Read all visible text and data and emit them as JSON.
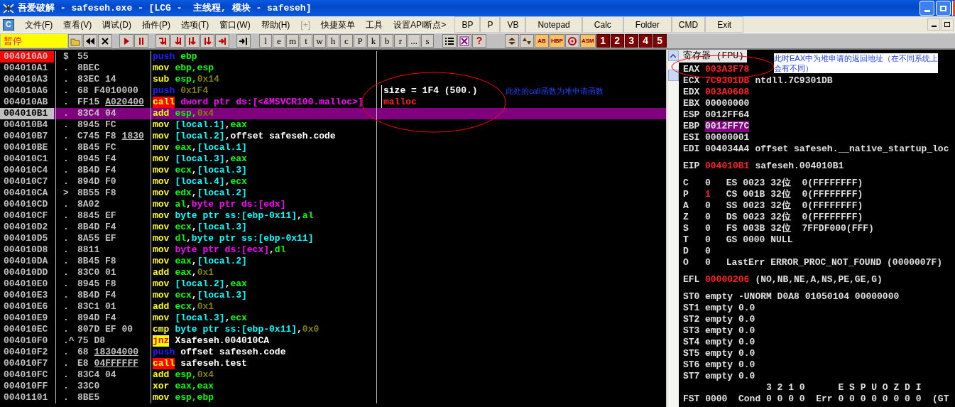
{
  "window": {
    "title": "吾爱破解 - safeseh.exe - [LCG -  主线程, 模块 - safeseh]"
  },
  "menu": {
    "icon_letter": "C",
    "items": [
      {
        "label": "文件(F)",
        "disabled": false
      },
      {
        "label": "查看(V)",
        "disabled": false
      },
      {
        "label": "调试(D)",
        "disabled": false
      },
      {
        "label": "插件(P)",
        "disabled": false
      },
      {
        "label": "选项(T)",
        "disabled": false
      },
      {
        "label": "窗口(W)",
        "disabled": false
      },
      {
        "label": "帮助(H)",
        "disabled": false
      },
      {
        "label": "[+]",
        "disabled": true
      },
      {
        "label": "快捷菜单",
        "disabled": false
      },
      {
        "label": "工具",
        "disabled": false
      },
      {
        "label": "设置API断点>",
        "disabled": false
      }
    ],
    "tool_buttons": [
      "BP",
      "P",
      "VB",
      "Notepad",
      "Calc",
      "Folder",
      "CMD",
      "Exit"
    ]
  },
  "toolbar": {
    "status": "暂停",
    "letter_buttons": [
      "l",
      "e",
      "m",
      "t",
      "w",
      "h",
      "c",
      "P",
      "k",
      "b",
      "r",
      "...",
      "s"
    ],
    "help": "?",
    "plugin_buttons": [
      {
        "kind": "swap"
      },
      {
        "kind": "sort"
      },
      {
        "kind": "text",
        "label": "AB"
      },
      {
        "kind": "text",
        "label": "HBP"
      },
      {
        "kind": "target"
      },
      {
        "kind": "text",
        "label": "ASM"
      }
    ],
    "number_buttons": [
      "1",
      "2",
      "3",
      "4",
      "5"
    ]
  },
  "disassembly": {
    "rows": [
      {
        "address": "004010A0",
        "mark": "$",
        "bytes": "55",
        "op": {
          "text": "push",
          "kind": "push"
        },
        "args": [
          {
            "text": "ebp",
            "kind": "reg"
          }
        ],
        "selected": false,
        "breakpoint": true
      },
      {
        "address": "004010A1",
        "mark": ".",
        "bytes": "8BEC",
        "op": {
          "text": "mov",
          "kind": "plain"
        },
        "args": [
          {
            "text": "ebp,esp",
            "kind": "reg"
          }
        ],
        "selected": false,
        "breakpoint": false
      },
      {
        "address": "004010A3",
        "mark": ".",
        "bytes": "83EC 14",
        "op": {
          "text": "sub",
          "kind": "plain"
        },
        "args": [
          {
            "text": "esp,",
            "kind": "reg"
          },
          {
            "text": "0x14",
            "kind": "const"
          }
        ],
        "selected": false,
        "breakpoint": false
      },
      {
        "address": "004010A6",
        "mark": ".",
        "bytes": "68 F4010000",
        "op": {
          "text": "push",
          "kind": "push"
        },
        "args": [
          {
            "text": "0x1F4",
            "kind": "const"
          }
        ],
        "comment": {
          "text": "size = 1F4 (500.)",
          "kind": "arg"
        },
        "selected": false,
        "breakpoint": false
      },
      {
        "address": "004010AB",
        "mark": ".",
        "bytes": "FF15",
        "operand_bytes": "A020400",
        "op": {
          "text": "call",
          "kind": "call"
        },
        "args": [
          {
            "text": "dword ptr ds:[<&MSVCR100.malloc>]",
            "kind": "ptr"
          }
        ],
        "comment": {
          "text": "malloc",
          "kind": "func"
        },
        "selected": false,
        "breakpoint": false
      },
      {
        "address": "004010B1",
        "mark": ".",
        "bytes": "83C4 04",
        "op": {
          "text": "add",
          "kind": "plain"
        },
        "args": [
          {
            "text": "esp,",
            "kind": "reg"
          },
          {
            "text": "0x4",
            "kind": "const"
          }
        ],
        "selected": true,
        "breakpoint": false
      },
      {
        "address": "004010B4",
        "mark": ".",
        "bytes": "8945 FC",
        "op": {
          "text": "mov",
          "kind": "plain"
        },
        "args": [
          {
            "text": "[local.1]",
            "kind": "mem"
          },
          {
            "text": ",",
            "kind": "text"
          },
          {
            "text": "eax",
            "kind": "reg"
          }
        ],
        "selected": false,
        "breakpoint": false
      },
      {
        "address": "004010B7",
        "mark": ".",
        "bytes": "C745 F8",
        "operand_bytes": "1830",
        "op": {
          "text": "mov",
          "kind": "plain"
        },
        "args": [
          {
            "text": "[local.2]",
            "kind": "mem"
          },
          {
            "text": ",offset safeseh.code",
            "kind": "text"
          }
        ],
        "selected": false,
        "breakpoint": false
      },
      {
        "address": "004010BE",
        "mark": ".",
        "bytes": "8B45 FC",
        "op": {
          "text": "mov",
          "kind": "plain"
        },
        "args": [
          {
            "text": "eax",
            "kind": "reg"
          },
          {
            "text": ",",
            "kind": "text"
          },
          {
            "text": "[local.1]",
            "kind": "mem"
          }
        ],
        "selected": false,
        "breakpoint": false
      },
      {
        "address": "004010C1",
        "mark": ".",
        "bytes": "8945 F4",
        "op": {
          "text": "mov",
          "kind": "plain"
        },
        "args": [
          {
            "text": "[local.3]",
            "kind": "mem"
          },
          {
            "text": ",",
            "kind": "text"
          },
          {
            "text": "eax",
            "kind": "reg"
          }
        ],
        "selected": false,
        "breakpoint": false
      },
      {
        "address": "004010C4",
        "mark": ".",
        "bytes": "8B4D F4",
        "op": {
          "text": "mov",
          "kind": "plain"
        },
        "args": [
          {
            "text": "ecx",
            "kind": "reg"
          },
          {
            "text": ",",
            "kind": "text"
          },
          {
            "text": "[local.3]",
            "kind": "mem"
          }
        ],
        "selected": false,
        "breakpoint": false
      },
      {
        "address": "004010C7",
        "mark": ".",
        "bytes": "894D F0",
        "op": {
          "text": "mov",
          "kind": "plain"
        },
        "args": [
          {
            "text": "[local.4]",
            "kind": "mem"
          },
          {
            "text": ",",
            "kind": "text"
          },
          {
            "text": "ecx",
            "kind": "reg"
          }
        ],
        "selected": false,
        "breakpoint": false
      },
      {
        "address": "004010CA",
        "mark": ">",
        "bytes": "8B55 F8",
        "op": {
          "text": "mov",
          "kind": "plain"
        },
        "args": [
          {
            "text": "edx",
            "kind": "reg"
          },
          {
            "text": ",",
            "kind": "text"
          },
          {
            "text": "[local.2]",
            "kind": "mem"
          }
        ],
        "selected": false,
        "breakpoint": false
      },
      {
        "address": "004010CD",
        "mark": ".",
        "bytes": "8A02",
        "op": {
          "text": "mov",
          "kind": "plain"
        },
        "args": [
          {
            "text": "al",
            "kind": "reg"
          },
          {
            "text": ",",
            "kind": "text"
          },
          {
            "text": "byte ptr ds:[edx]",
            "kind": "ptr"
          }
        ],
        "selected": false,
        "breakpoint": false
      },
      {
        "address": "004010CF",
        "mark": ".",
        "bytes": "8845 EF",
        "op": {
          "text": "mov",
          "kind": "plain"
        },
        "args": [
          {
            "text": "byte ptr ss:[ebp-0x11]",
            "kind": "mem"
          },
          {
            "text": ",",
            "kind": "text"
          },
          {
            "text": "al",
            "kind": "reg"
          }
        ],
        "selected": false,
        "breakpoint": false
      },
      {
        "address": "004010D2",
        "mark": ".",
        "bytes": "8B4D F4",
        "op": {
          "text": "mov",
          "kind": "plain"
        },
        "args": [
          {
            "text": "ecx",
            "kind": "reg"
          },
          {
            "text": ",",
            "kind": "text"
          },
          {
            "text": "[local.3]",
            "kind": "mem"
          }
        ],
        "selected": false,
        "breakpoint": false
      },
      {
        "address": "004010D5",
        "mark": ".",
        "bytes": "8A55 EF",
        "op": {
          "text": "mov",
          "kind": "plain"
        },
        "args": [
          {
            "text": "dl",
            "kind": "reg"
          },
          {
            "text": ",",
            "kind": "text"
          },
          {
            "text": "byte ptr ss:[ebp-0x11]",
            "kind": "mem"
          }
        ],
        "selected": false,
        "breakpoint": false
      },
      {
        "address": "004010D8",
        "mark": ".",
        "bytes": "8811",
        "op": {
          "text": "mov",
          "kind": "plain"
        },
        "args": [
          {
            "text": "byte ptr ds:[ecx]",
            "kind": "ptr"
          },
          {
            "text": ",",
            "kind": "text"
          },
          {
            "text": "dl",
            "kind": "reg"
          }
        ],
        "selected": false,
        "breakpoint": false
      },
      {
        "address": "004010DA",
        "mark": ".",
        "bytes": "8B45 F8",
        "op": {
          "text": "mov",
          "kind": "plain"
        },
        "args": [
          {
            "text": "eax",
            "kind": "reg"
          },
          {
            "text": ",",
            "kind": "text"
          },
          {
            "text": "[local.2]",
            "kind": "mem"
          }
        ],
        "selected": false,
        "breakpoint": false
      },
      {
        "address": "004010DD",
        "mark": ".",
        "bytes": "83C0 01",
        "op": {
          "text": "add",
          "kind": "plain"
        },
        "args": [
          {
            "text": "eax",
            "kind": "reg"
          },
          {
            "text": ",",
            "kind": "text"
          },
          {
            "text": "0x1",
            "kind": "const"
          }
        ],
        "selected": false,
        "breakpoint": false
      },
      {
        "address": "004010E0",
        "mark": ".",
        "bytes": "8945 F8",
        "op": {
          "text": "mov",
          "kind": "plain"
        },
        "args": [
          {
            "text": "[local.2]",
            "kind": "mem"
          },
          {
            "text": ",",
            "kind": "text"
          },
          {
            "text": "eax",
            "kind": "reg"
          }
        ],
        "selected": false,
        "breakpoint": false
      },
      {
        "address": "004010E3",
        "mark": ".",
        "bytes": "8B4D F4",
        "op": {
          "text": "mov",
          "kind": "plain"
        },
        "args": [
          {
            "text": "ecx",
            "kind": "reg"
          },
          {
            "text": ",",
            "kind": "text"
          },
          {
            "text": "[local.3]",
            "kind": "mem"
          }
        ],
        "selected": false,
        "breakpoint": false
      },
      {
        "address": "004010E6",
        "mark": ".",
        "bytes": "83C1 01",
        "op": {
          "text": "add",
          "kind": "plain"
        },
        "args": [
          {
            "text": "ecx",
            "kind": "reg"
          },
          {
            "text": ",",
            "kind": "text"
          },
          {
            "text": "0x1",
            "kind": "const"
          }
        ],
        "selected": false,
        "breakpoint": false
      },
      {
        "address": "004010E9",
        "mark": ".",
        "bytes": "894D F4",
        "op": {
          "text": "mov",
          "kind": "plain"
        },
        "args": [
          {
            "text": "[local.3]",
            "kind": "mem"
          },
          {
            "text": ",",
            "kind": "text"
          },
          {
            "text": "ecx",
            "kind": "reg"
          }
        ],
        "selected": false,
        "breakpoint": false
      },
      {
        "address": "004010EC",
        "mark": ".",
        "bytes": "807D EF 00",
        "op": {
          "text": "cmp",
          "kind": "plain"
        },
        "args": [
          {
            "text": "byte ptr ss:[ebp-0x11]",
            "kind": "mem"
          },
          {
            "text": ",",
            "kind": "text"
          },
          {
            "text": "0x0",
            "kind": "const"
          }
        ],
        "selected": false,
        "breakpoint": false
      },
      {
        "address": "004010F0",
        "mark": ".^",
        "bytes": "75 D8",
        "op": {
          "text": "jnz",
          "kind": "jump"
        },
        "args": [
          {
            "text": "Xsafeseh.004010CA",
            "kind": "text"
          }
        ],
        "selected": false,
        "breakpoint": false
      },
      {
        "address": "004010F2",
        "mark": ".",
        "bytes": "68",
        "operand_bytes": "18304000",
        "op": {
          "text": "push",
          "kind": "push"
        },
        "args": [
          {
            "text": "offset safeseh.code",
            "kind": "text"
          }
        ],
        "selected": false,
        "breakpoint": false
      },
      {
        "address": "004010F7",
        "mark": ".",
        "bytes": "E8",
        "operand_bytes": "04FFFFFF",
        "op": {
          "text": "call",
          "kind": "call"
        },
        "args": [
          {
            "text": "safeseh.test",
            "kind": "text"
          }
        ],
        "selected": false,
        "breakpoint": false
      },
      {
        "address": "004010FC",
        "mark": ".",
        "bytes": "83C4 04",
        "op": {
          "text": "add",
          "kind": "plain"
        },
        "args": [
          {
            "text": "esp,",
            "kind": "reg"
          },
          {
            "text": "0x4",
            "kind": "const"
          }
        ],
        "selected": false,
        "breakpoint": false
      },
      {
        "address": "004010FF",
        "mark": ".",
        "bytes": "33C0",
        "op": {
          "text": "xor",
          "kind": "plain"
        },
        "args": [
          {
            "text": "eax,eax",
            "kind": "reg"
          }
        ],
        "selected": false,
        "breakpoint": false
      },
      {
        "address": "00401101",
        "mark": ".",
        "bytes": "8BE5",
        "op": {
          "text": "mov",
          "kind": "plain"
        },
        "args": [
          {
            "text": "esp,ebp",
            "kind": "reg"
          }
        ],
        "selected": false,
        "breakpoint": false
      }
    ],
    "note": "此处的call函数为堆申请函数"
  },
  "registers": {
    "title": "寄存器 (FPU)",
    "note_lines": [
      "此时EAX中为堆申请的返回地址（在不同系统上",
      "会有不同）"
    ],
    "groups": [
      [
        {
          "name": "EAX",
          "value": "003A3F78",
          "changed": true,
          "selected": false
        },
        {
          "name": "ECX",
          "value": "7C9301DB",
          "changed": true,
          "selected": false,
          "note": "ntdll.7C9301DB"
        },
        {
          "name": "EDX",
          "value": "003A0608",
          "changed": true,
          "selected": false
        },
        {
          "name": "EBX",
          "value": "00000000",
          "changed": false,
          "selected": false
        },
        {
          "name": "ESP",
          "value": "0012FF64",
          "changed": false,
          "selected": false
        },
        {
          "name": "EBP",
          "value": "0012FF7C",
          "changed": false,
          "selected": true
        },
        {
          "name": "ESI",
          "value": "00000001",
          "changed": false,
          "selected": false
        },
        {
          "name": "EDI",
          "value": "004034A4",
          "changed": false,
          "selected": false,
          "note": "offset safeseh.__native_startup_loc"
        }
      ],
      [
        {
          "name": "EIP",
          "value": "004010B1",
          "changed": true,
          "selected": false,
          "note": "safeseh.004010B1"
        }
      ],
      [
        {
          "name": "C",
          "value": "0",
          "changed": false,
          "selected": false,
          "note": "ES 0023 32位  0(FFFFFFFF)"
        },
        {
          "name": "P",
          "value": "1",
          "changed": true,
          "selected": false,
          "note": "CS 001B 32位  0(FFFFFFFF)"
        },
        {
          "name": "A",
          "value": "0",
          "changed": false,
          "selected": false,
          "note": "SS 0023 32位  0(FFFFFFFF)"
        },
        {
          "name": "Z",
          "value": "0",
          "changed": false,
          "selected": false,
          "note": "DS 0023 32位  0(FFFFFFFF)"
        },
        {
          "name": "S",
          "value": "0",
          "changed": false,
          "selected": false,
          "note": "FS 003B 32位  7FFDF000(FFF)"
        },
        {
          "name": "T",
          "value": "0",
          "changed": false,
          "selected": false,
          "note": "GS 0000 NULL"
        },
        {
          "name": "D",
          "value": "0",
          "changed": false,
          "selected": false
        },
        {
          "name": "O",
          "value": "0",
          "changed": false,
          "selected": false,
          "note": "LastErr ERROR_PROC_NOT_FOUND (0000007F)"
        }
      ],
      [
        {
          "name": "EFL",
          "value": "00000206",
          "changed": true,
          "selected": false,
          "note": "(NO,NB,NE,A,NS,PE,GE,G)"
        }
      ],
      [
        {
          "name": "ST0",
          "value": "empty",
          "changed": false,
          "selected": false,
          "note": "-UNORM D0A8 01050104 00000000"
        },
        {
          "name": "ST1",
          "value": "empty",
          "changed": false,
          "selected": false,
          "note": "0.0"
        },
        {
          "name": "ST2",
          "value": "empty",
          "changed": false,
          "selected": false,
          "note": "0.0"
        },
        {
          "name": "ST3",
          "value": "empty",
          "changed": false,
          "selected": false,
          "note": "0.0"
        },
        {
          "name": "ST4",
          "value": "empty",
          "changed": false,
          "selected": false,
          "note": "0.0"
        },
        {
          "name": "ST5",
          "value": "empty",
          "changed": false,
          "selected": false,
          "note": "0.0"
        },
        {
          "name": "ST6",
          "value": "empty",
          "changed": false,
          "selected": false,
          "note": "0.0"
        },
        {
          "name": "ST7",
          "value": "empty",
          "changed": false,
          "selected": false,
          "note": "0.0"
        }
      ]
    ],
    "footer_lines": [
      "               3 2 1 0      E S P U O Z D I",
      "FST 0000  Cond 0 0 0 0  Err 0 0 0 0 0 0 0 0  (GT"
    ]
  }
}
